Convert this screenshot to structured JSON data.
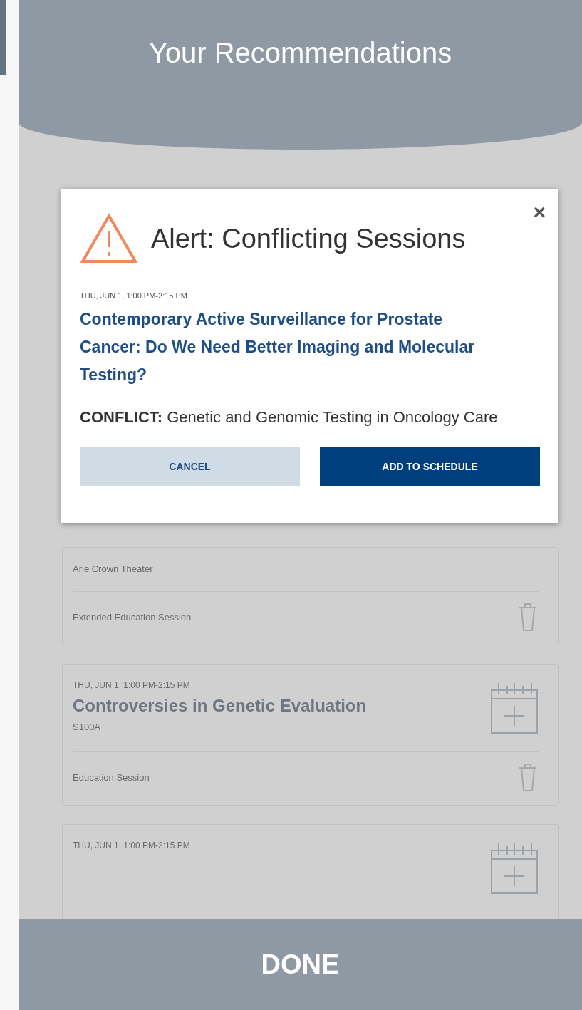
{
  "header": {
    "title": "Your Recommendations"
  },
  "cards": [
    {
      "venue": "Arie Crown Theater",
      "type": "Extended Education Session"
    },
    {
      "date": "THU, JUN 1, 1:00 PM-2:15 PM",
      "title": "Controversies in Genetic Evaluation",
      "room": "S100A",
      "type": "Education Session"
    },
    {
      "date": "THU, JUN 1, 1:00 PM-2:15 PM"
    }
  ],
  "modal": {
    "title": "Alert: Conflicting Sessions",
    "close": "×",
    "date": "THU, JUN 1, 1:00 PM-2:15 PM",
    "session_title": "Contemporary Active Surveillance for Prostate Cancer: Do We Need Better Imaging and Molecular Testing?",
    "conflict": "**CONFLICT:** Genetic and Genomic Testing in Oncology Care",
    "buttons": [
      {
        "label": "CANCEL",
        "kind": "secondary"
      },
      {
        "label": "ADD TO SCHEDULE",
        "kind": "primary"
      }
    ]
  },
  "footer": {
    "button": "DONE"
  }
}
